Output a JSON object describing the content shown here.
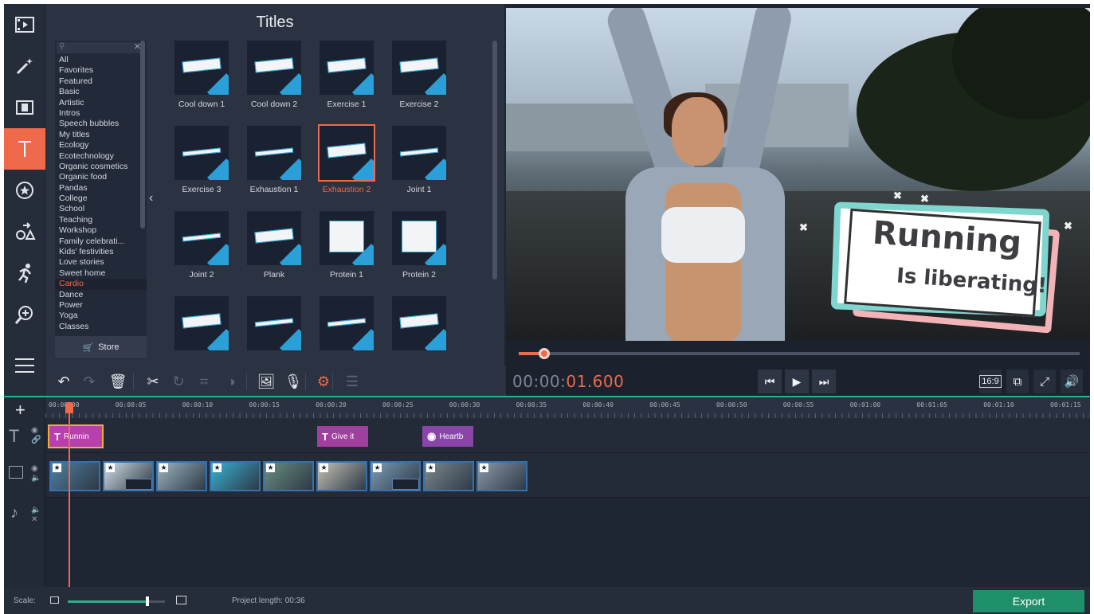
{
  "side_tools": [
    {
      "icon": "film-import-icon"
    },
    {
      "icon": "magic-wand-icon"
    },
    {
      "icon": "filters-icon"
    },
    {
      "icon": "titles-icon",
      "active": true
    },
    {
      "icon": "stickers-icon"
    },
    {
      "icon": "shapes-icon"
    },
    {
      "icon": "running-man-icon"
    },
    {
      "icon": "zoom-icon"
    },
    {
      "icon": "menu-list-icon"
    }
  ],
  "titles_panel": {
    "heading": "Titles",
    "categories": [
      "All",
      "Favorites",
      "Featured",
      "Basic",
      "Artistic",
      "Intros",
      "Speech bubbles",
      "My titles",
      "Ecology",
      "Ecotechnology",
      "Organic cosmetics",
      "Organic food",
      "Pandas",
      "College",
      "School",
      "Teaching",
      "Workshop",
      "Family celebrati...",
      "Kids' festivities",
      "Love stories",
      "Sweet home",
      "Cardio",
      "Dance",
      "Power",
      "Yoga",
      "Classes"
    ],
    "selected_category": "Cardio",
    "store_label": "Store",
    "tiles": [
      {
        "name": "Cool down 1",
        "style": "card"
      },
      {
        "name": "Cool down 2",
        "style": "card"
      },
      {
        "name": "Exercise 1",
        "style": "card"
      },
      {
        "name": "Exercise 2",
        "style": "card"
      },
      {
        "name": "Exercise 3",
        "style": "thin"
      },
      {
        "name": "Exhaustion 1",
        "style": "thin"
      },
      {
        "name": "Exhaustion 2",
        "style": "card",
        "selected": true
      },
      {
        "name": "Joint 1",
        "style": "thin"
      },
      {
        "name": "Joint 2",
        "style": "thin"
      },
      {
        "name": "Plank",
        "style": "card"
      },
      {
        "name": "Protein 1",
        "style": "tall"
      },
      {
        "name": "Protein 2",
        "style": "tall"
      },
      {
        "name": "",
        "style": "card"
      },
      {
        "name": "",
        "style": "thin"
      },
      {
        "name": "",
        "style": "thin"
      },
      {
        "name": "",
        "style": "card"
      }
    ]
  },
  "preview": {
    "overlay_line1": "Running",
    "overlay_line2": "Is liberating!",
    "progress_fraction": 0.046
  },
  "edit_toolbar": [
    {
      "icon": "undo-icon",
      "state": "on"
    },
    {
      "icon": "redo-icon",
      "state": "dim"
    },
    {
      "icon": "delete-icon",
      "state": "on"
    },
    {
      "icon": "cut-icon",
      "state": "on"
    },
    {
      "icon": "rotate-icon",
      "state": "dim"
    },
    {
      "icon": "crop-icon",
      "state": "dim"
    },
    {
      "icon": "color-adjust-icon",
      "state": "dim"
    },
    {
      "icon": "image-icon",
      "state": "on"
    },
    {
      "icon": "microphone-icon",
      "state": "on"
    },
    {
      "icon": "settings-gear-icon",
      "state": "orange"
    },
    {
      "icon": "equalizer-icon",
      "state": "dim"
    }
  ],
  "playback": {
    "timecode_dim": "00:00:",
    "timecode_active": "01.600",
    "ratio_label": "16:9"
  },
  "timeline": {
    "ruler_labels": [
      "00:00:00",
      "00:00:05",
      "00:00:10",
      "00:00:15",
      "00:00:20",
      "00:00:25",
      "00:00:30",
      "00:00:35",
      "00:00:40",
      "00:00:45",
      "00:00:50",
      "00:00:55",
      "00:01:00",
      "00:01:05",
      "00:01:10",
      "00:01:15"
    ],
    "title_clips": [
      {
        "label": "Runnin",
        "color": "#b73fae"
      },
      {
        "label": "Give it",
        "color": "#a13f9f"
      },
      {
        "label": "Heartb",
        "color": "#8a45a8"
      }
    ],
    "video_clip_colors": [
      "#4f7fa0",
      "#d3dee6",
      "#9db5bf",
      "#38b2d4",
      "#6b8f80",
      "#c6c2b5",
      "#7d9cb5",
      "#7e8a8d",
      "#8c99a8"
    ]
  },
  "status": {
    "scale_label": "Scale:",
    "scale_fraction": 0.8,
    "project_length_label": "Project length:",
    "project_length_value": "00:36",
    "export_label": "Export"
  },
  "colors": {
    "accent": "#ef6a4b",
    "export": "#1f8f6a",
    "timeline_accent": "#2ab08a"
  }
}
